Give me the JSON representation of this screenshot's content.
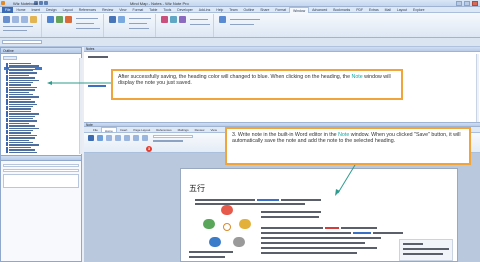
{
  "titlebar": {
    "app_title": "Wiz Notebook",
    "document": "Mind Map - Notes - Wiz Note Pro",
    "window_controls": [
      "minimize-icon",
      "maximize-icon",
      "close-icon"
    ]
  },
  "ribbon": {
    "tabs": [
      "File",
      "Home",
      "Insert",
      "Design",
      "Layout",
      "References",
      "Review",
      "View",
      "Format",
      "Table",
      "Tools",
      "Developer",
      "Add-ins",
      "Help",
      "Team",
      "Outline",
      "Share",
      "Format",
      "Window",
      "Advanced",
      "Bookmarks",
      "PDF",
      "Extras",
      "Mail",
      "Layout",
      "Explore"
    ],
    "active_tab_index": 18
  },
  "left_pane": {
    "header": "Outline",
    "selected_item_index": 2,
    "item_count": 38,
    "accent": "#3f77c9"
  },
  "main": {
    "header": "Notes",
    "note_header": "Note",
    "note_tabs": [
      "File",
      "Home",
      "Insert",
      "Page Layout",
      "References",
      "Mailings",
      "Review",
      "View"
    ]
  },
  "callouts": {
    "saved_pre": "After successfully saving, the heading color will changed to blue. When clicking on the heading, the ",
    "saved_note": "Note",
    "saved_post": " window will display the note you just saved.",
    "word_pre": "3. Write note in the built-in Word editor in the ",
    "word_note": "Note",
    "word_post": " window. When you clicked \"Save\" button, it will automatically save the note and add the note to the selected heading.",
    "border_color": "#f0a43a",
    "note_color": "#13a6a1"
  },
  "badge": {
    "value": "3"
  },
  "document": {
    "title": "五行"
  },
  "icons": [
    "app-icon",
    "save-icon",
    "undo-icon",
    "redo-icon"
  ]
}
